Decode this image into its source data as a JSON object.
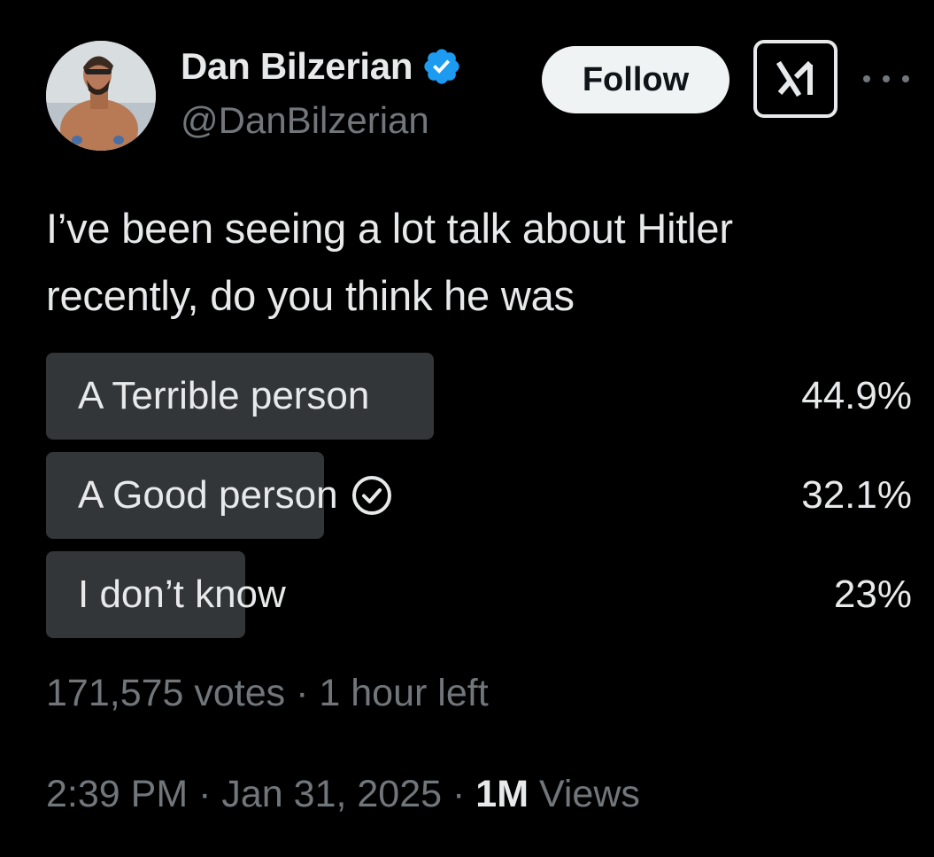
{
  "author": {
    "display_name": "Dan Bilzerian",
    "handle": "@DanBilzerian",
    "verified_color": "#1d9bf0"
  },
  "header": {
    "follow_label": "Follow",
    "grok_icon": "grok-icon",
    "more_icon": "more-icon"
  },
  "tweet": {
    "text": "I’ve been seeing a lot talk about Hitler recently, do you think he was"
  },
  "poll": {
    "options": [
      {
        "label": "A Terrible person",
        "percent_label": "44.9%",
        "percent": 44.9,
        "selected": false
      },
      {
        "label": "A Good person",
        "percent_label": "32.1%",
        "percent": 32.1,
        "selected": true
      },
      {
        "label": "I don’t know",
        "percent_label": "23%",
        "percent": 23,
        "selected": false
      }
    ],
    "votes": "171,575 votes",
    "sep": "·",
    "time_left": "1 hour left",
    "bar_color": "#333639"
  },
  "meta": {
    "time": "2:39 PM",
    "sep": "·",
    "date": "Jan 31, 2025",
    "views_count": "1M",
    "views_label": "Views"
  },
  "colors": {
    "background": "#000000",
    "primary_text": "#e7e9ea",
    "secondary_text": "#71767b",
    "follow_bg": "#eff3f4"
  }
}
